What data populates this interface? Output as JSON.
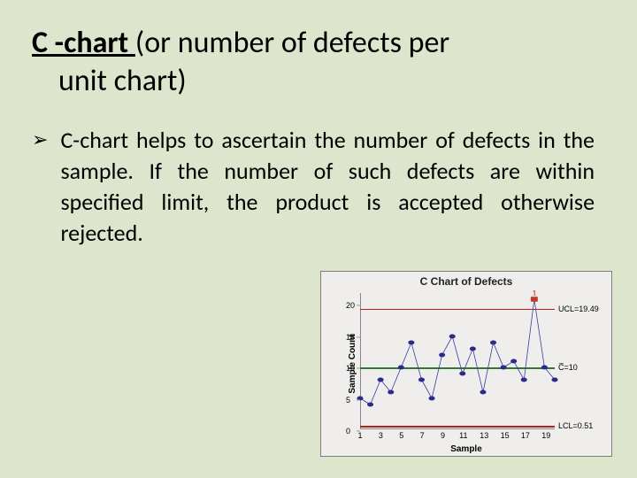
{
  "title_underlined": "C -chart ",
  "title_rest1": "(or number of defects per",
  "title_rest2": "unit chart)",
  "bullet_marker": "➢",
  "bullet_text": "C-chart helps to ascertain the number of defects in the sample. If the number of such defects are within specified limit, the product is accepted otherwise rejected.",
  "chart_data": {
    "type": "line",
    "title": "C Chart of Defects",
    "xlabel": "Sample",
    "ylabel": "Sample Count",
    "ylim": [
      0,
      22
    ],
    "yticks": [
      0,
      5,
      10,
      15,
      20
    ],
    "xticks": [
      1,
      3,
      5,
      7,
      9,
      11,
      13,
      15,
      17,
      19
    ],
    "x": [
      1,
      2,
      3,
      4,
      5,
      6,
      7,
      8,
      9,
      10,
      11,
      12,
      13,
      14,
      15,
      16,
      17,
      18,
      19,
      20
    ],
    "values": [
      5,
      4,
      8,
      6,
      10,
      14,
      8,
      5,
      12,
      15,
      9,
      13,
      6,
      14,
      10,
      11,
      8,
      21,
      10,
      8
    ],
    "center_line": 10,
    "ucl": 19.49,
    "lcl": 0.51,
    "labels": {
      "ucl": "UCL=19.49",
      "cl": "C̅=10",
      "lcl": "LCL=0.51"
    },
    "out_of_control": [
      {
        "x": 18,
        "value": 21,
        "label": "1"
      }
    ],
    "point_color": "#2b2b8a",
    "line_color": "#3a3aa8",
    "ooc_color": "#c0392b"
  }
}
